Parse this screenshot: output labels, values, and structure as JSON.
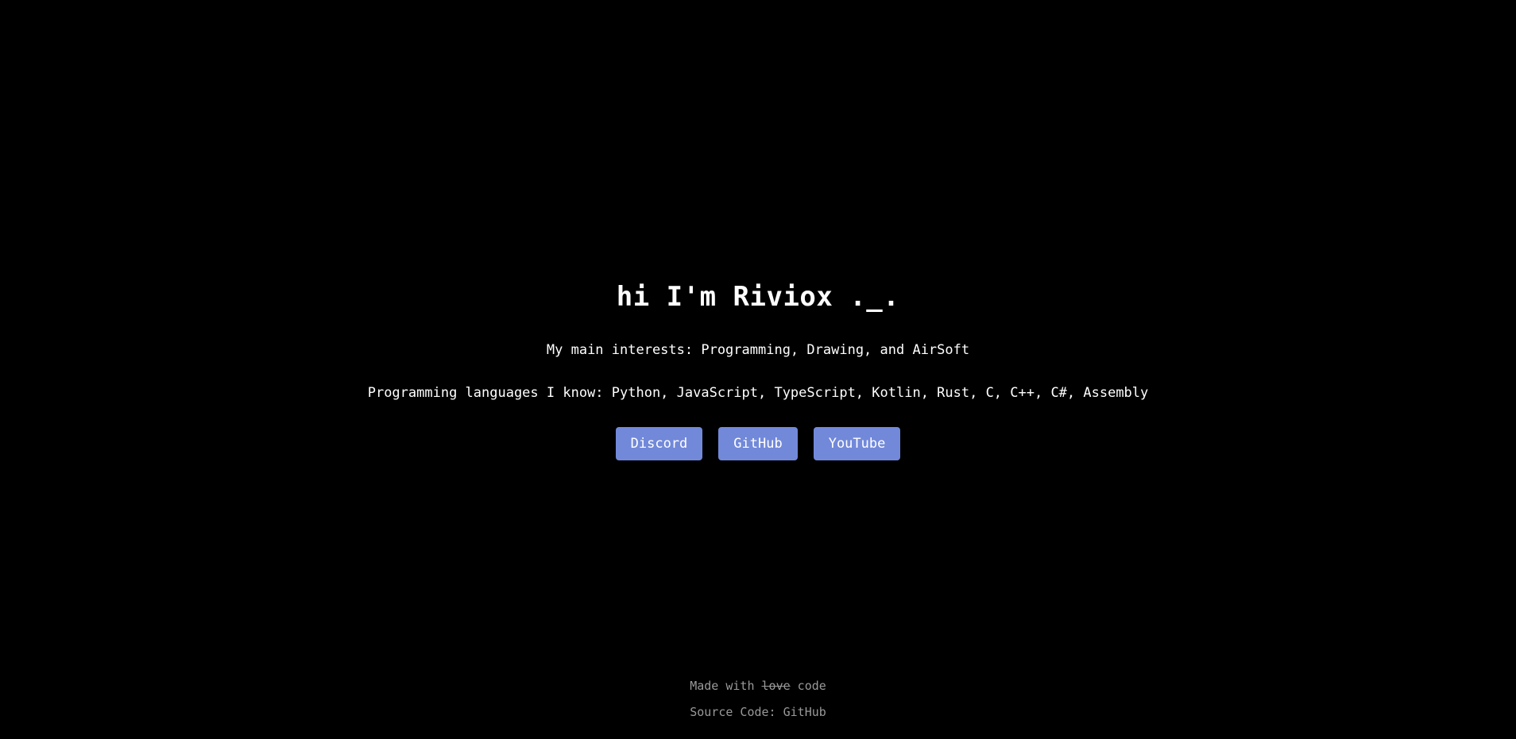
{
  "hero": {
    "title": "hi I'm Riviox ._.",
    "interests": "My main interests: Programming, Drawing, and AirSoft",
    "languages": "Programming languages I know: Python, JavaScript, TypeScript, Kotlin, Rust, C, C++, C#, Assembly"
  },
  "links": {
    "discord": "Discord",
    "github": "GitHub",
    "youtube": "YouTube"
  },
  "footer": {
    "made_prefix": "Made with ",
    "made_struck": "love",
    "made_suffix": " code",
    "source_label": "Source Code: ",
    "source_link": "GitHub"
  },
  "colors": {
    "background": "#000000",
    "button": "#7289da",
    "footer_text": "#999999"
  }
}
